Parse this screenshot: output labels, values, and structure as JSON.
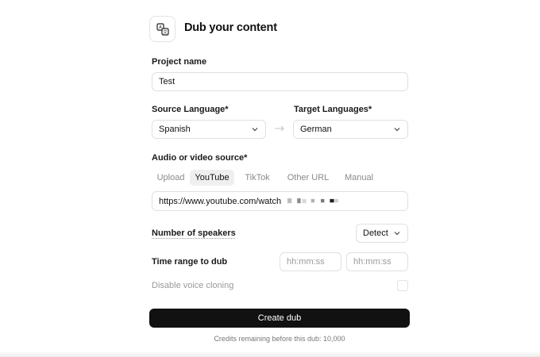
{
  "header": {
    "title": "Dub your content",
    "logo_icon": "translate-icon"
  },
  "project": {
    "label": "Project name",
    "value": "Test"
  },
  "languages": {
    "source_label": "Source Language*",
    "source_value": "Spanish",
    "target_label": "Target Languages*",
    "target_value": "German",
    "arrow_icon": "arrow-right-icon"
  },
  "source": {
    "label": "Audio or video source*",
    "tabs": [
      {
        "label": "Upload",
        "active": false
      },
      {
        "label": "YouTube",
        "active": true
      },
      {
        "label": "TikTok",
        "active": false
      },
      {
        "label": "Other URL",
        "active": false
      },
      {
        "label": "Manual",
        "active": false
      }
    ],
    "url_value": "https://www.youtube.com/watch"
  },
  "speakers": {
    "label": "Number of speakers",
    "value": "Detect"
  },
  "time_range": {
    "label": "Time range to dub",
    "start_placeholder": "hh:mm:ss",
    "end_placeholder": "hh:mm:ss"
  },
  "voice_cloning": {
    "label": "Disable voice cloning",
    "checked": false
  },
  "actions": {
    "create_label": "Create dub"
  },
  "footer": {
    "credits_text": "Credits remaining before this dub: 10,000"
  },
  "colors": {
    "primary_button": "#111111",
    "active_tab_bg": "#efefef",
    "border": "#e0e0e0"
  }
}
